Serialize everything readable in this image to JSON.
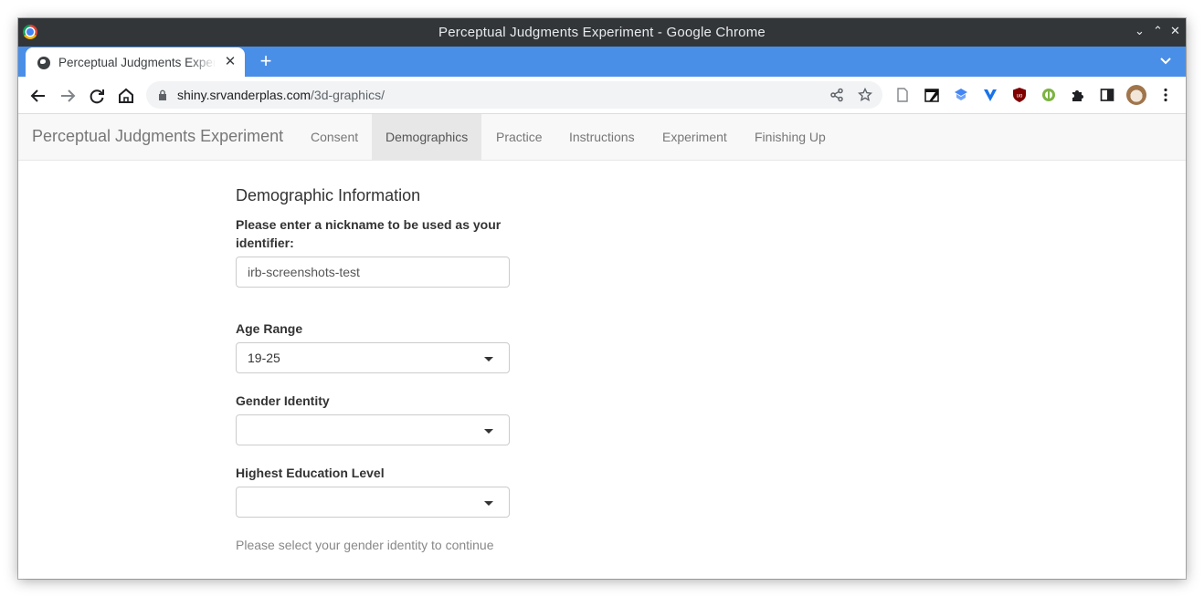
{
  "window": {
    "title": "Perceptual Judgments Experiment - Google Chrome",
    "controls": {
      "minimize": "⌄",
      "maximize": "⌃",
      "close": "✕"
    }
  },
  "tab": {
    "title": "Perceptual Judgments Experiment",
    "close": "✕",
    "new_tab": "+"
  },
  "address_bar": {
    "domain": "shiny.srvanderplas.com",
    "path": "/3d-graphics/"
  },
  "navbar": {
    "brand": "Perceptual Judgments Experiment",
    "items": [
      {
        "label": "Consent",
        "active": false
      },
      {
        "label": "Demographics",
        "active": true
      },
      {
        "label": "Practice",
        "active": false
      },
      {
        "label": "Instructions",
        "active": false
      },
      {
        "label": "Experiment",
        "active": false
      },
      {
        "label": "Finishing Up",
        "active": false
      }
    ]
  },
  "form": {
    "heading": "Demographic Information",
    "nickname": {
      "label": "Please enter a nickname to be used as your identifier:",
      "value": "irb-screenshots-test"
    },
    "age": {
      "label": "Age Range",
      "value": "19-25"
    },
    "gender": {
      "label": "Gender Identity",
      "value": ""
    },
    "education": {
      "label": "Highest Education Level",
      "value": ""
    },
    "status": "Please select your gender identity to continue"
  },
  "colors": {
    "titlebar": "#323639",
    "tabstrip": "#4a8fe7",
    "navbar_bg": "#f8f8f8",
    "navbar_active": "#e7e7e7",
    "nav_text": "#777777"
  }
}
